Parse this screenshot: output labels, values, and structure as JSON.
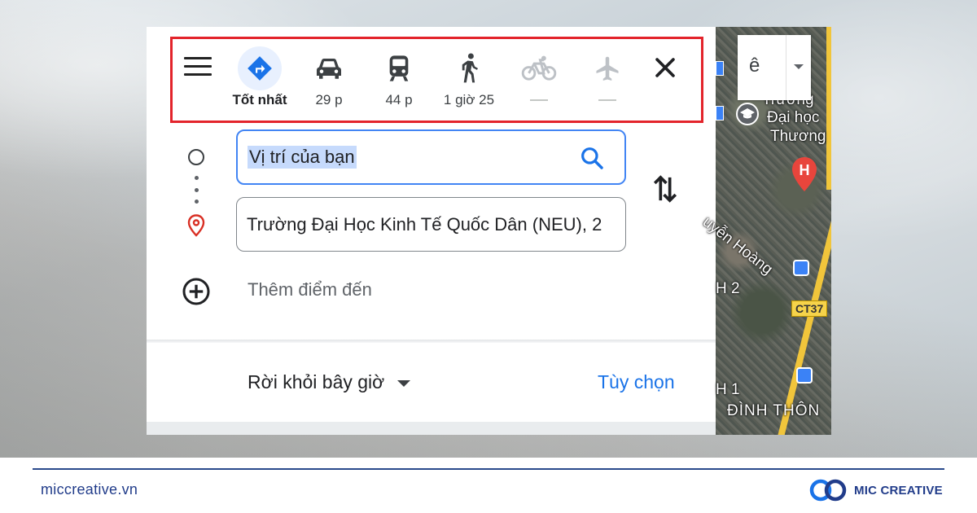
{
  "modes": [
    {
      "label": "Tốt nhất",
      "icon": "directions-icon"
    },
    {
      "label": "29 p",
      "icon": "car-icon"
    },
    {
      "label": "44 p",
      "icon": "transit-icon"
    },
    {
      "label": "1 giờ 25",
      "icon": "walk-icon"
    },
    {
      "label": "",
      "icon": "bike-icon"
    },
    {
      "label": "",
      "icon": "flight-icon"
    }
  ],
  "origin": {
    "value": "Vị trí của bạn"
  },
  "destination": {
    "value": "Trường Đại Học Kinh Tế Quốc Dân (NEU), 2"
  },
  "add_destination": "Thêm điểm đến",
  "depart": "Rời khỏi bây giờ",
  "options": "Tùy chọn",
  "map": {
    "lang_letter": "ê",
    "labels": [
      "Trường",
      "Đại học",
      "Thương",
      "uyễn Hoàng",
      "H 2",
      "H 1",
      "ĐÌNH THÔN"
    ],
    "road_label": "CT37"
  },
  "footer": {
    "site": "miccreative.vn",
    "brand": "MIC CREATIVE"
  },
  "colors": {
    "accent": "#1a73e8",
    "highlight": "#e3242b",
    "brand": "#213c8a"
  }
}
